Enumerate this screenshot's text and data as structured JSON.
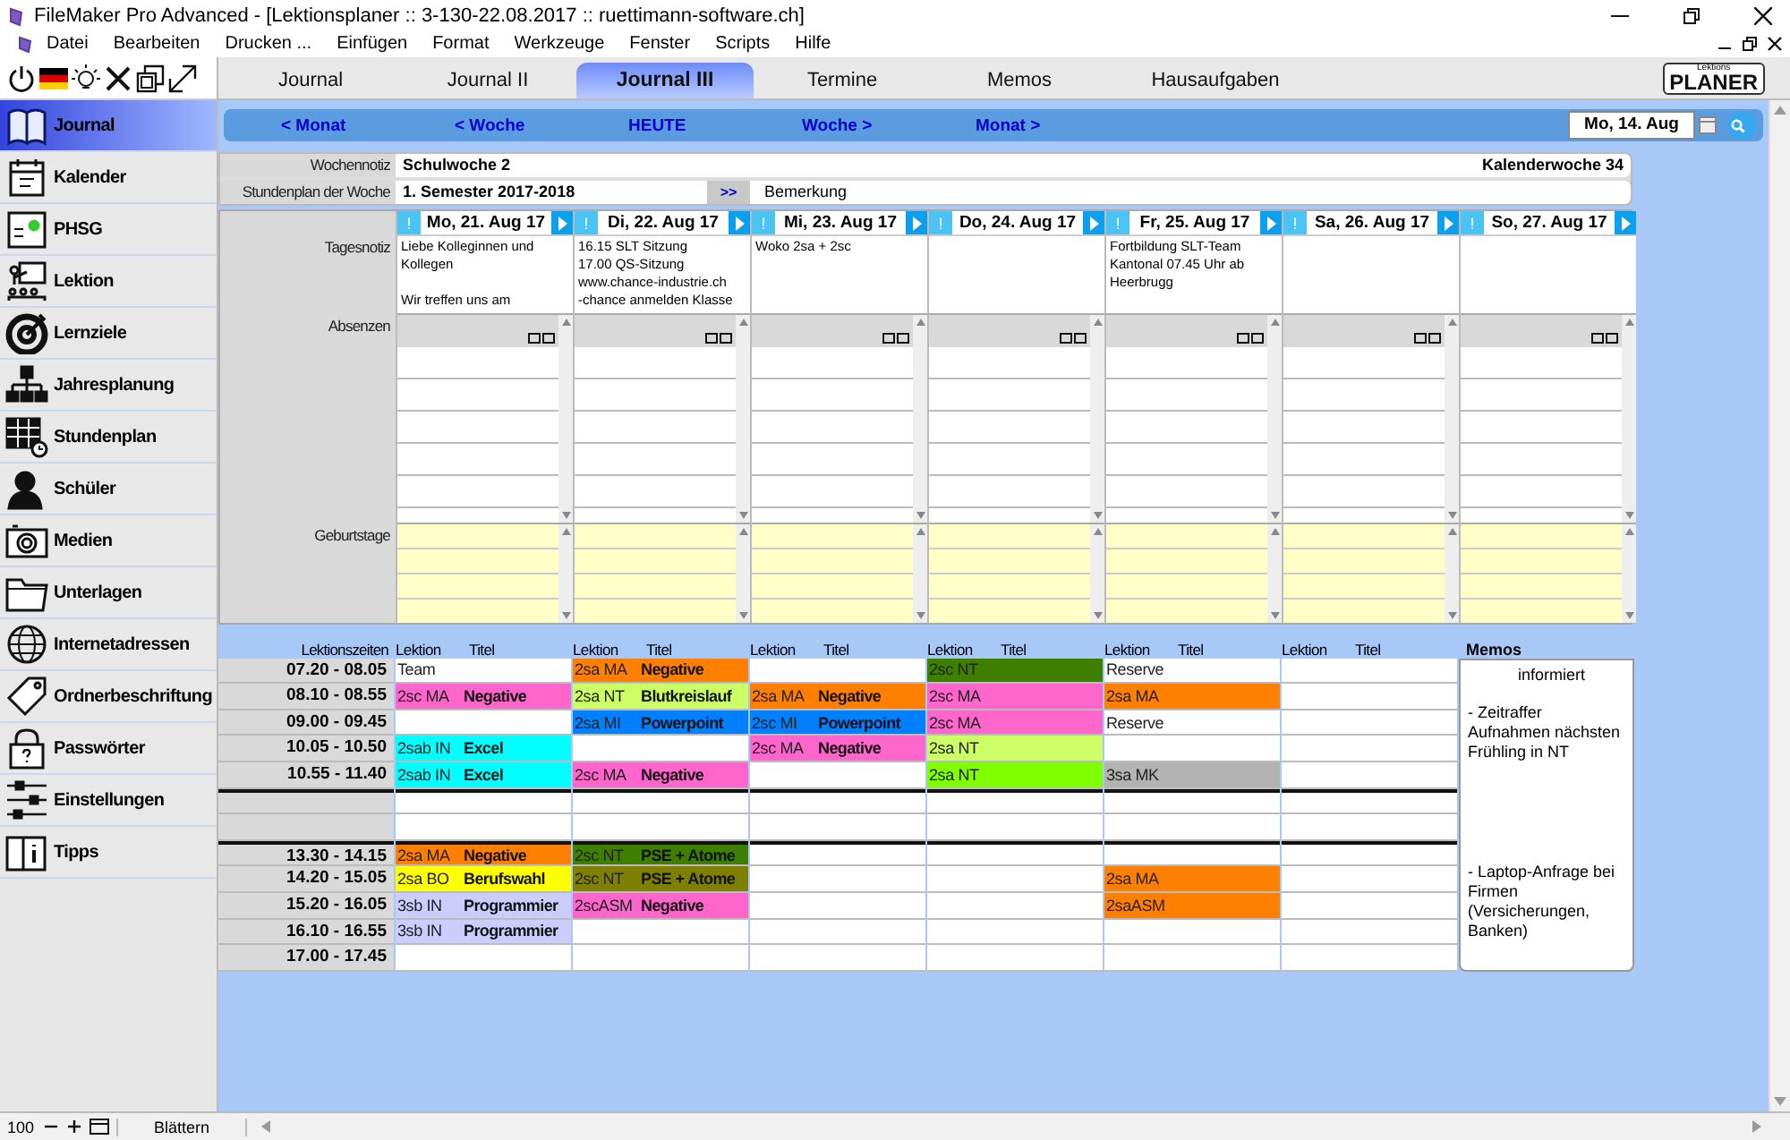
{
  "window": {
    "title": "FileMaker Pro Advanced - [Lektionsplaner :: 3-130-22.08.2017 :: ruettimann-software.ch]"
  },
  "menu": [
    "Datei",
    "Bearbeiten",
    "Drucken ...",
    "Einfügen",
    "Format",
    "Werkzeuge",
    "Fenster",
    "Scripts",
    "Hilfe"
  ],
  "sidebar": {
    "items": [
      {
        "label": "Journal",
        "selected": true
      },
      {
        "label": "Kalender",
        "selected": false
      },
      {
        "label": "PHSG",
        "selected": false
      },
      {
        "label": "Lektion",
        "selected": false
      },
      {
        "label": "Lernziele",
        "selected": false
      },
      {
        "label": "Jahresplanung",
        "selected": false
      },
      {
        "label": "Stundenplan",
        "selected": false
      },
      {
        "label": "Schüler",
        "selected": false
      },
      {
        "label": "Medien",
        "selected": false
      },
      {
        "label": "Unterlagen",
        "selected": false
      },
      {
        "label": "Internetadressen",
        "selected": false
      },
      {
        "label": "Ordnerbeschriftung",
        "selected": false
      },
      {
        "label": "Passwörter",
        "selected": false
      },
      {
        "label": "Einstellungen",
        "selected": false
      },
      {
        "label": "Tipps",
        "selected": false
      }
    ]
  },
  "tabs": [
    {
      "label": "Journal",
      "selected": false
    },
    {
      "label": "Journal II",
      "selected": false
    },
    {
      "label": "Journal III",
      "selected": true
    },
    {
      "label": "Termine",
      "selected": false
    },
    {
      "label": "Memos",
      "selected": false
    },
    {
      "label": "Hausaufgaben",
      "selected": false
    }
  ],
  "logo": {
    "small": "Lektions",
    "main": "PLANER"
  },
  "nav": {
    "links": [
      "< Monat",
      "< Woche",
      "HEUTE",
      "Woche >",
      "Monat >"
    ],
    "date": "Mo, 14. Aug"
  },
  "week": {
    "note_label": "Wochennotiz",
    "note": "Schulwoche 2",
    "week_number": "Kalenderwoche 34",
    "plan_label": "Stundenplan der Woche",
    "plan": "1. Semester 2017-2018",
    "plan_button": ">>",
    "remark": "Bemerkung",
    "day_note_label": "Tagesnotiz",
    "absences_label": "Absenzen",
    "birthdays_label": "Geburtstage",
    "days": [
      {
        "flag": "!",
        "date": "Mo, 21. Aug 17",
        "note": "Liebe Kolleginnen und Kollegen\n\nWir treffen uns am"
      },
      {
        "flag": "!",
        "date": "Di, 22. Aug 17",
        "note": "16.15 SLT Sitzung\n17.00 QS-Sitzung\nwww.chance-industrie.ch\n-chance anmelden Klasse"
      },
      {
        "flag": "!",
        "date": "Mi, 23. Aug 17",
        "note": "Woko 2sa + 2sc"
      },
      {
        "flag": "!",
        "date": "Do, 24. Aug 17"
      },
      {
        "flag": "!",
        "date": "Fr, 25. Aug 17",
        "note": "Fortbildung SLT-Team Kantonal 07.45 Uhr ab Heerbrugg"
      },
      {
        "flag": "!",
        "date": "Sa, 26. Aug 17"
      },
      {
        "flag": "!",
        "date": "So, 27. Aug 17"
      }
    ]
  },
  "lessons": {
    "label": "Lektionszeiten",
    "headers": [
      {
        "lesson": "Lektion",
        "title": "Titel"
      },
      {
        "lesson": "Lektion",
        "title": "Titel"
      },
      {
        "lesson": "Lektion",
        "title": "Titel"
      },
      {
        "lesson": "Lektion",
        "title": "Titel"
      },
      {
        "lesson": "Lektion",
        "title": "Titel"
      },
      {
        "lesson": "Lektion",
        "title": "Titel"
      }
    ],
    "rows": [
      {
        "kind": "lesson",
        "time": "07.20 - 08.05",
        "cells": [
          {
            "lesson": "Team"
          },
          {
            "lesson": "2sa MA",
            "title": "Negative",
            "color": "#ff8000"
          },
          {},
          {
            "lesson": "2sc NT",
            "color": "#3f7f00"
          },
          {
            "lesson": "Reserve"
          },
          {}
        ]
      },
      {
        "kind": "lesson",
        "time": "08.10 - 08.55",
        "cells": [
          {
            "lesson": "2sc MA",
            "title": "Negative",
            "color": "#ff66cc"
          },
          {
            "lesson": "2sa NT",
            "title": "Blutkreislauf",
            "color": "#ccff66"
          },
          {
            "lesson": "2sa MA",
            "title": "Negative",
            "color": "#ff8000"
          },
          {
            "lesson": "2sc MA",
            "color": "#ff66cc"
          },
          {
            "lesson": "2sa MA",
            "color": "#ff8000"
          },
          {}
        ]
      },
      {
        "kind": "lesson",
        "time": "09.00 - 09.45",
        "cells": [
          {},
          {
            "lesson": "2sa MI",
            "title": "Powerpoint",
            "color": "#0080ff"
          },
          {
            "lesson": "2sc MI",
            "title": "Powerpoint",
            "color": "#0080ff"
          },
          {
            "lesson": "2sc MA",
            "color": "#ff66cc"
          },
          {
            "lesson": "Reserve"
          },
          {}
        ]
      },
      {
        "kind": "lesson",
        "time": "10.05 - 10.50",
        "cells": [
          {
            "lesson": "2sab IN",
            "title": "Excel",
            "color": "#00ffff"
          },
          {},
          {
            "lesson": "2sc MA",
            "title": "Negative",
            "color": "#ff66cc"
          },
          {
            "lesson": "2sa NT",
            "color": "#ccff66"
          },
          {},
          {}
        ]
      },
      {
        "kind": "lesson",
        "time": "10.55 - 11.40",
        "cells": [
          {
            "lesson": "2sab IN",
            "title": "Excel",
            "color": "#00ffff"
          },
          {
            "lesson": "2sc MA",
            "title": "Negative",
            "color": "#ff66cc"
          },
          {},
          {
            "lesson": "2sa NT",
            "color": "#80ff00"
          },
          {
            "lesson": "3sa MK",
            "color": "#b3b3b3"
          },
          {}
        ]
      },
      {
        "kind": "break"
      },
      {
        "kind": "break"
      },
      {
        "kind": "lesson",
        "time": "13.30 - 14.15",
        "cells": [
          {
            "lesson": "2sa MA",
            "title": "Negative",
            "color": "#ff8000"
          },
          {
            "lesson": "2sc NT",
            "title": "PSE + Atome",
            "color": "#3f7f00"
          },
          {},
          {},
          {},
          {}
        ]
      },
      {
        "kind": "lesson",
        "time": "14.20 - 15.05",
        "cells": [
          {
            "lesson": "2sa BO",
            "title": "Berufswahl",
            "color": "#ffff00"
          },
          {
            "lesson": "2sc NT",
            "title": "PSE + Atome",
            "color": "#7f7f00"
          },
          {},
          {},
          {
            "lesson": "2sa MA",
            "color": "#ff8000"
          },
          {}
        ]
      },
      {
        "kind": "lesson",
        "time": "15.20 - 16.05",
        "cells": [
          {
            "lesson": "3sb IN",
            "title": "Programmier",
            "color": "#ccccff"
          },
          {
            "lesson": "2scASM",
            "title": "Negative",
            "color": "#ff66cc"
          },
          {},
          {},
          {
            "lesson": "2saASM",
            "color": "#ff8000"
          },
          {}
        ]
      },
      {
        "kind": "lesson",
        "time": "16.10 - 16.55",
        "cells": [
          {
            "lesson": "3sb IN",
            "title": "Programmier",
            "color": "#ccccff"
          },
          {},
          {},
          {},
          {},
          {}
        ]
      },
      {
        "kind": "lesson",
        "time": "17.00 - 17.45",
        "cells": [
          {},
          {},
          {},
          {},
          {},
          {}
        ]
      }
    ]
  },
  "memos": {
    "title": "Memos",
    "items": [
      "informiert",
      "- Zeitraffer Aufnahmen nächsten Frühling in NT",
      "- Laptop-Anfrage bei Firmen (Versicherungen, Banken)"
    ]
  },
  "status_bar": {
    "zoom": "100",
    "mode": "Blättern"
  }
}
